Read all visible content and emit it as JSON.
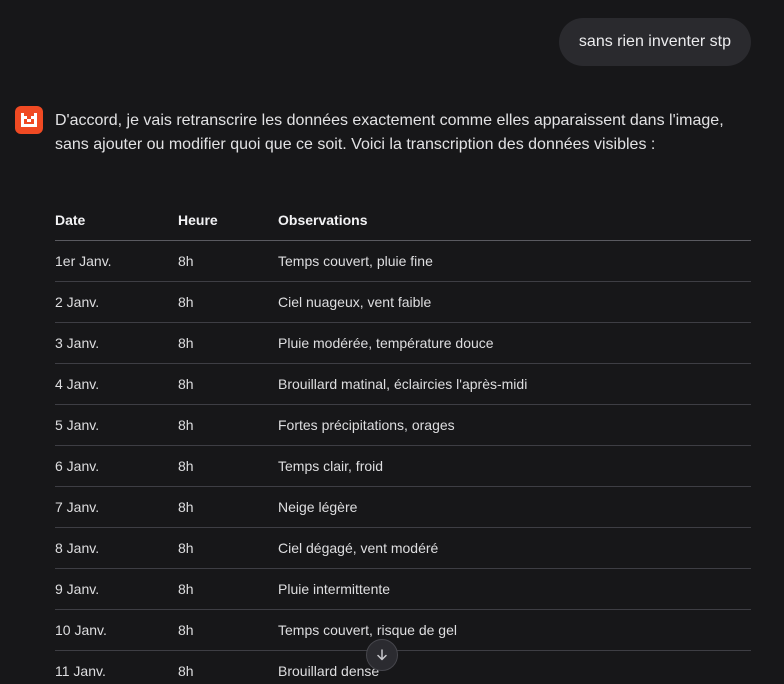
{
  "user_message": "sans rien inventer stp",
  "assistant": {
    "icon": "brand-logo-icon",
    "brand_color": "#f04a23",
    "intro": "D'accord, je vais retranscrire les données exactement comme elles apparaissent dans l'image, sans ajouter ou modifier quoi que ce soit. Voici la transcription des données visibles :"
  },
  "table": {
    "headers": [
      "Date",
      "Heure",
      "Observations"
    ],
    "rows": [
      [
        "1er Janv.",
        "8h",
        "Temps couvert, pluie fine"
      ],
      [
        "2 Janv.",
        "8h",
        "Ciel nuageux, vent faible"
      ],
      [
        "3 Janv.",
        "8h",
        "Pluie modérée, température douce"
      ],
      [
        "4 Janv.",
        "8h",
        "Brouillard matinal, éclaircies l'après-midi"
      ],
      [
        "5 Janv.",
        "8h",
        "Fortes précipitations, orages"
      ],
      [
        "6 Janv.",
        "8h",
        "Temps clair, froid"
      ],
      [
        "7 Janv.",
        "8h",
        "Neige légère"
      ],
      [
        "8 Janv.",
        "8h",
        "Ciel dégagé, vent modéré"
      ],
      [
        "9 Janv.",
        "8h",
        "Pluie intermittente"
      ],
      [
        "10 Janv.",
        "8h",
        "Temps couvert, risque de gel"
      ],
      [
        "11 Janv.",
        "8h",
        "Brouillard dense"
      ]
    ]
  },
  "scroll_button": {
    "icon": "arrow-down-icon"
  }
}
